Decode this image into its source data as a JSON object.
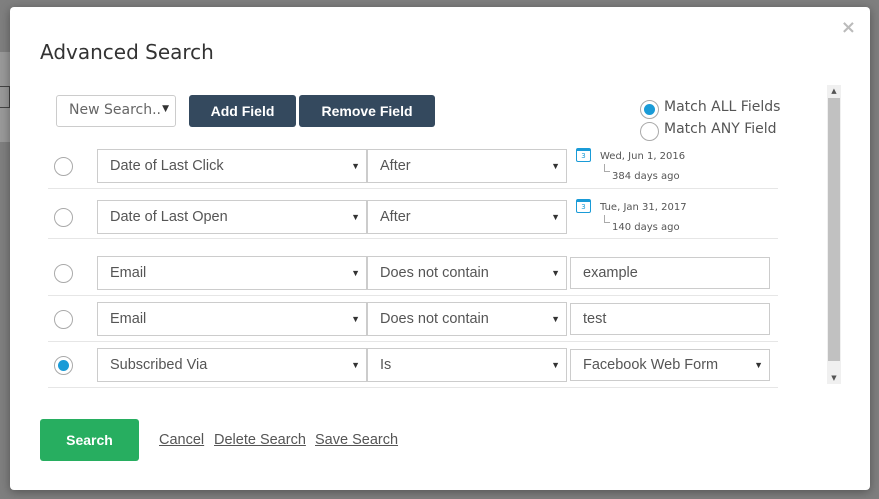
{
  "modal": {
    "title": "Advanced Search",
    "close_icon": "×"
  },
  "toolbar": {
    "new_search": "New Search..",
    "add_field": "Add Field",
    "remove_field": "Remove Field",
    "match_all": "Match ALL Fields",
    "match_any": "Match ANY Field",
    "match_selected": "all"
  },
  "rows": [
    {
      "field": "Date of Last Click",
      "operator": "After",
      "date": "Wed, Jun 1, 2016",
      "ago": "384 days ago",
      "calendar_day": "3",
      "selected": false
    },
    {
      "field": "Date of Last Open",
      "operator": "After",
      "date": "Tue, Jan 31, 2017",
      "ago": "140 days ago",
      "calendar_day": "3",
      "selected": false
    },
    {
      "field": "Email",
      "operator": "Does not contain",
      "value": "example",
      "selected": false
    },
    {
      "field": "Email",
      "operator": "Does not contain",
      "value": "test",
      "selected": false
    },
    {
      "field": "Subscribed Via",
      "operator": "Is",
      "value": "Facebook Web Form",
      "selected": true
    }
  ],
  "footer": {
    "search": "Search",
    "cancel": "Cancel",
    "delete_search": "Delete Search",
    "save_search": "Save Search"
  },
  "colors": {
    "accent_blue": "#1a9bd7",
    "dark_button": "#34495e",
    "search_green": "#27ae60"
  }
}
